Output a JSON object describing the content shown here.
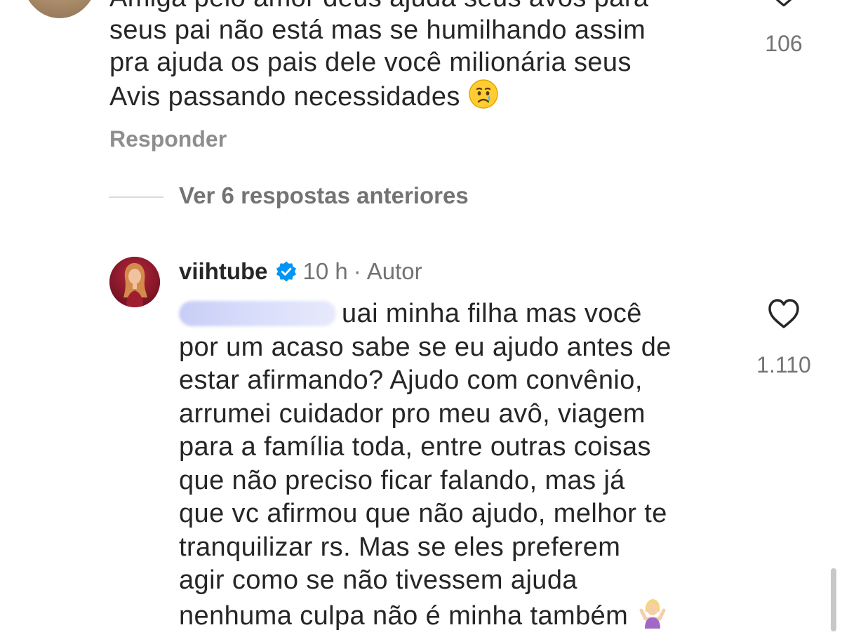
{
  "first_comment": {
    "lines": [
      "Amiga pelo amor deus ajuda seus avós para",
      "seus pai não está mas se humilhando assim",
      "pra ajuda os pais dele você milionária seus",
      "Avis passando necessidades"
    ],
    "emoji": "crying-face",
    "reply_label": "Responder",
    "like_count": "106"
  },
  "view_previous_replies": "Ver 6 respostas anteriores",
  "author_reply": {
    "username": "viihtube",
    "verified": true,
    "time": "10 h",
    "separator": "·",
    "author_label": "Autor",
    "lines": [
      "uai minha filha mas você",
      "por um acaso sabe se eu ajudo antes de",
      "estar afirmando? Ajudo com convênio,",
      "arrumei cuidador pro meu avô, viagem",
      "para a família toda, entre outras coisas",
      "que não preciso ficar falando, mas já",
      "que vc afirmou que não ajudo, melhor te",
      "tranquilizar rs. Mas se eles preferem",
      "agir como se não tivessem ajuda",
      "nenhuma culpa não é minha também"
    ],
    "emoji": "person-shrugging",
    "like_count": "1.110"
  },
  "colors": {
    "text": "#262626",
    "secondary": "#737373",
    "verified_blue": "#0095f6",
    "divider": "#dbdbdb"
  }
}
